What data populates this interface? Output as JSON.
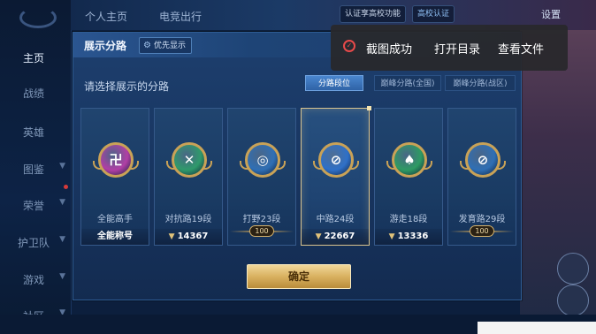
{
  "sidebar": {
    "items": [
      {
        "label": "主页",
        "active": true
      },
      {
        "label": "战绩"
      },
      {
        "label": "英雄"
      },
      {
        "label": "图鉴",
        "chevron": true
      },
      {
        "label": "荣誉",
        "chevron": true
      },
      {
        "label": "护卫队",
        "chevron": true
      },
      {
        "label": "游戏",
        "chevron": true
      },
      {
        "label": "社区",
        "chevron": true
      }
    ]
  },
  "topbar": {
    "tabs": [
      "个人主页",
      "电竞出行"
    ],
    "certify_label": "认证享高校功能",
    "school_label": "高校认证",
    "settings_label": "设置"
  },
  "panel": {
    "title": "展示分路",
    "priority_label": "优先显示",
    "subtitle": "请选择展示的分路",
    "segments": [
      {
        "label": "分路段位",
        "active": true
      },
      {
        "label": "巅峰分路(全国)",
        "active": false
      },
      {
        "label": "巅峰分路(战区)",
        "active": false
      }
    ],
    "roles": [
      {
        "name": "全能高手",
        "score": "全能称号",
        "emblem": "all-round-icon",
        "color": "#b13fa5",
        "glyph": "卍",
        "badge": ""
      },
      {
        "name": "对抗路19段",
        "score": "14367",
        "emblem": "clash-lane-icon",
        "color": "#2f9a6b",
        "glyph": "✕",
        "badge": ""
      },
      {
        "name": "打野23段",
        "score": "",
        "emblem": "jungle-icon",
        "color": "#2f6fb5",
        "glyph": "◎",
        "badge": "100"
      },
      {
        "name": "中路24段",
        "score": "22667",
        "emblem": "mid-lane-icon",
        "color": "#2f70c8",
        "glyph": "⊘",
        "badge": "",
        "selected": true
      },
      {
        "name": "游走18段",
        "score": "13336",
        "emblem": "roam-icon",
        "color": "#2e9b63",
        "glyph": "♠",
        "badge": ""
      },
      {
        "name": "发育路29段",
        "score": "",
        "emblem": "farm-lane-icon",
        "color": "#2f6fb5",
        "glyph": "⊘",
        "badge": "100"
      }
    ],
    "confirm_label": "确定"
  },
  "toast": {
    "message": "截图成功",
    "open_folder": "打开目录",
    "view_file": "查看文件",
    "accent": "#e84a4a"
  }
}
